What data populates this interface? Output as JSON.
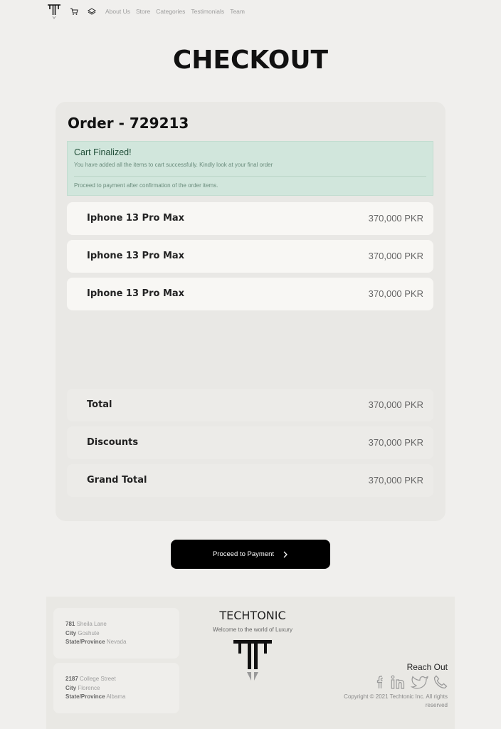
{
  "nav": {
    "links": [
      "About Us",
      "Store",
      "Categories",
      "Testimonials",
      "Team"
    ],
    "icons": [
      "logo-icon",
      "cart-icon",
      "layers-icon"
    ]
  },
  "page_title": "CHECKOUT",
  "order": {
    "title": "Order - 729213",
    "alert": {
      "heading": "Cart Finalized!",
      "line1": "You have added all the items to cart successfully. Kindly look at your final order",
      "line2": "Proceed to payment after confirmation of the order items."
    },
    "items": [
      {
        "name": "Iphone 13 Pro Max",
        "price": "370,000 PKR"
      },
      {
        "name": "Iphone 13 Pro Max",
        "price": "370,000 PKR"
      },
      {
        "name": "Iphone 13 Pro Max",
        "price": "370,000 PKR"
      }
    ],
    "summary": [
      {
        "name": "Total",
        "price": "370,000 PKR"
      },
      {
        "name": "Discounts",
        "price": "370,000 PKR"
      },
      {
        "name": "Grand Total",
        "price": "370,000 PKR"
      }
    ]
  },
  "pay_button": "Proceed to Payment",
  "footer": {
    "addresses": [
      {
        "street_no": "781",
        "street": "Sheila Lane",
        "city_label": "City",
        "city": "Goshute",
        "state_label": "State/Province",
        "state": "Nevada"
      },
      {
        "street_no": "2187",
        "street": "College Street",
        "city_label": "City",
        "city": "Florence",
        "state_label": "State/Province",
        "state": "Albama"
      }
    ],
    "brand": "TECHTONIC",
    "tagline": "Welcome to the world of Luxury",
    "reach_out": "Reach Out",
    "copyright_1": "Copyright © 2021 Techtonic Inc. All rights",
    "copyright_2": "reserved",
    "socials": [
      "facebook-icon",
      "linkedin-icon",
      "twitter-icon",
      "phone-icon"
    ]
  }
}
